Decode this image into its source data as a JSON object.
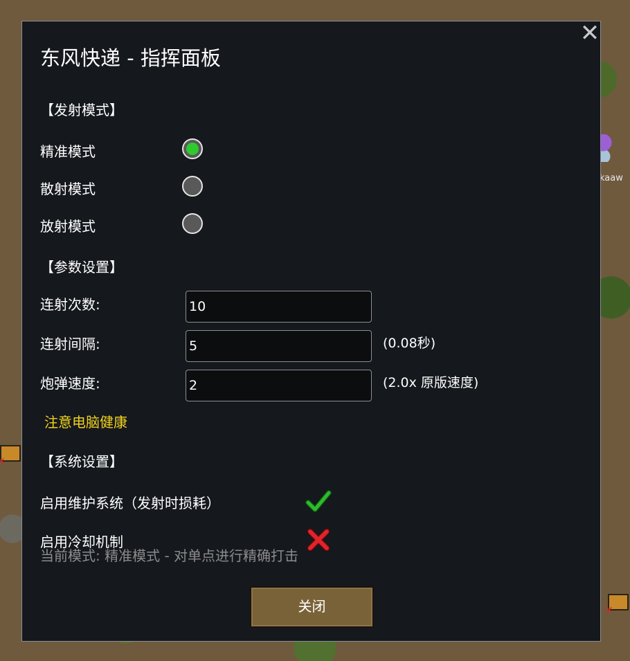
{
  "map": {
    "pawn_name": "kaaw"
  },
  "dialog": {
    "title": "东风快递 - 指挥面板",
    "close_glyph": "✕",
    "fire_mode": {
      "heading": "【发射模式】",
      "options": [
        {
          "label": "精准模式",
          "selected": true
        },
        {
          "label": "散射模式",
          "selected": false
        },
        {
          "label": "放射模式",
          "selected": false
        }
      ]
    },
    "params": {
      "heading": "【参数设置】",
      "burst_count": {
        "label": "连射次数:",
        "value": "10"
      },
      "burst_interval": {
        "label": "连射间隔:",
        "value": "5",
        "note": "(0.08秒)"
      },
      "shell_speed": {
        "label": "炮弹速度:",
        "value": "2",
        "note": "(2.0x 原版速度)"
      },
      "warning": "注意电脑健康"
    },
    "system": {
      "heading": "【系统设置】",
      "maintenance": {
        "label": "启用维护系统（发射时损耗）",
        "enabled": true,
        "icon": "checkmark-icon"
      },
      "cooldown": {
        "label": "启用冷却机制",
        "enabled": false,
        "icon": "cross-icon"
      }
    },
    "status_line": "当前模式: 精准模式 - 对单点进行精确打击",
    "close_button": "关闭"
  },
  "colors": {
    "panel_bg": "#15181d",
    "radio_selected": "#2dcb2d",
    "warning_text": "#f0d21c",
    "check_green": "#2dbb2d",
    "cross_red": "#e0242a",
    "button_bg": "#7a6238"
  }
}
